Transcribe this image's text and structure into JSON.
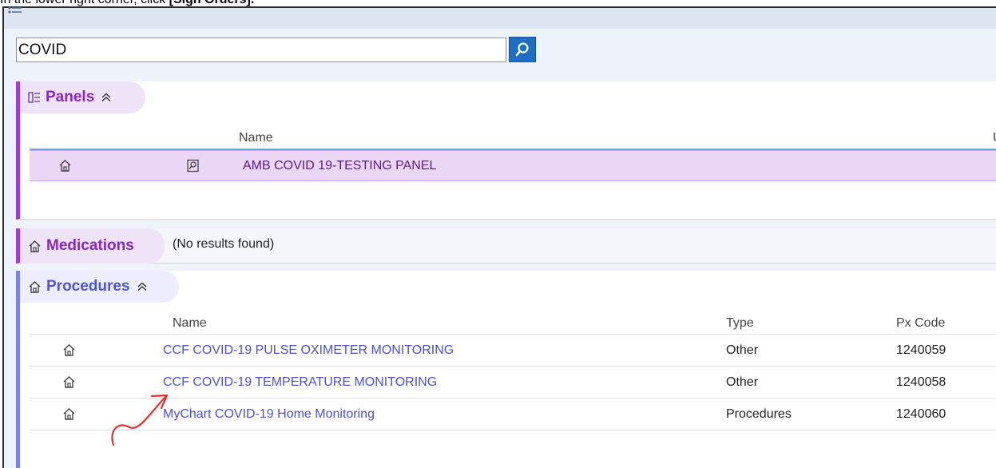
{
  "instruction": {
    "prefix": "In the lower right corner, click ",
    "bold": "[Sign Orders]."
  },
  "search": {
    "value": "COVID",
    "button_icon": "search-icon"
  },
  "panels": {
    "title": "Panels",
    "columns": {
      "name": "Name",
      "extra": "U"
    },
    "rows": [
      {
        "name": "AMB COVID 19-TESTING PANEL"
      }
    ]
  },
  "medications": {
    "title": "Medications",
    "status": "(No results found)"
  },
  "procedures": {
    "title": "Procedures",
    "columns": {
      "name": "Name",
      "type": "Type",
      "code": "Px Code"
    },
    "rows": [
      {
        "name": "CCF COVID-19 PULSE OXIMETER MONITORING",
        "type": "Other",
        "code": "1240059"
      },
      {
        "name": "CCF COVID-19 TEMPERATURE MONITORING",
        "type": "Other",
        "code": "1240058"
      },
      {
        "name": "MyChart COVID-19 Home Monitoring",
        "type": "Procedures",
        "code": "1240060"
      }
    ]
  },
  "colors": {
    "panel_accent": "#a03bd6",
    "procedure_accent": "#7b82f0",
    "search_button": "#1e6fc3",
    "annotation_arrow": "#e0342b"
  }
}
